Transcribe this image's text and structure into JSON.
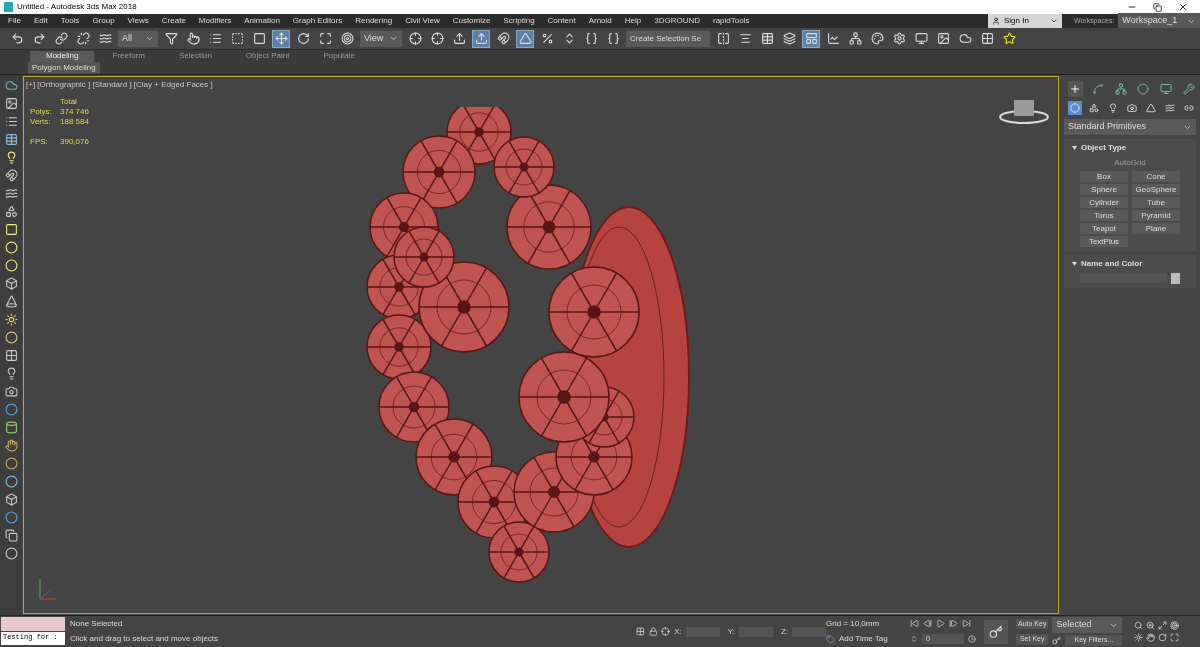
{
  "window": {
    "title": "Untitled - Autodesk 3ds Max 2018"
  },
  "menu": [
    "File",
    "Edit",
    "Tools",
    "Group",
    "Views",
    "Create",
    "Modifiers",
    "Animation",
    "Graph Editors",
    "Rendering",
    "Civil View",
    "Customize",
    "Scripting",
    "Content",
    "Arnold",
    "Help",
    "3DGROUND",
    "rapidTools"
  ],
  "account": {
    "sign_in": "Sign In",
    "workspaces_label": "Workspaces:",
    "workspace": "Workspace_1"
  },
  "toolbar": {
    "selection_filter": "All",
    "reference_coord": "View",
    "named_selection": "Create Selection Se",
    "buttons": [
      {
        "kind": "undo",
        "selected": false
      },
      {
        "kind": "redo",
        "selected": false
      },
      {
        "kind": "link",
        "selected": false
      },
      {
        "kind": "unlink",
        "selected": false
      },
      {
        "kind": "bind",
        "selected": false
      },
      {
        "kind": "filter",
        "selected": false
      },
      {
        "kind": "select",
        "selected": false
      },
      {
        "kind": "list",
        "selected": false
      },
      {
        "kind": "region",
        "selected": false
      },
      {
        "kind": "window",
        "selected": false
      },
      {
        "kind": "move",
        "selected": true
      },
      {
        "kind": "rotate",
        "selected": false
      },
      {
        "kind": "scale",
        "selected": false
      },
      {
        "kind": "place",
        "selected": false
      },
      {
        "kind": "coord",
        "selected": false
      },
      {
        "kind": "pivot",
        "selected": false
      },
      {
        "kind": "manip",
        "selected": false
      },
      {
        "kind": "keyboard",
        "selected": true
      },
      {
        "kind": "snap",
        "selected": false
      },
      {
        "kind": "angle",
        "selected": true
      },
      {
        "kind": "percent",
        "selected": false
      },
      {
        "kind": "spinner",
        "selected": false
      },
      {
        "kind": "edit-named",
        "selected": false
      },
      {
        "kind": "named",
        "selected": false
      },
      {
        "kind": "mirror",
        "selected": false
      },
      {
        "kind": "align",
        "selected": false
      },
      {
        "kind": "layers",
        "selected": false
      },
      {
        "kind": "layer-stack",
        "selected": false
      },
      {
        "kind": "ribbon",
        "selected": true
      },
      {
        "kind": "curve",
        "selected": false
      },
      {
        "kind": "schematic",
        "selected": false
      },
      {
        "kind": "material",
        "selected": false
      },
      {
        "kind": "render-setup",
        "selected": false
      },
      {
        "kind": "render-frame",
        "selected": false
      },
      {
        "kind": "render",
        "selected": false
      },
      {
        "kind": "cloud",
        "selected": false
      },
      {
        "kind": "grid",
        "selected": false
      },
      {
        "kind": "star",
        "selected": false
      }
    ]
  },
  "ribbon": {
    "tabs": [
      {
        "label": "Modeling",
        "selected": true
      },
      {
        "label": "Freeform",
        "selected": false
      },
      {
        "label": "Selection",
        "selected": false
      },
      {
        "label": "Object Paint",
        "selected": false
      },
      {
        "label": "Populate",
        "selected": false
      }
    ],
    "panel": "Polygon Modeling"
  },
  "viewport": {
    "label": "[+] [Orthographic ] [Standard ] [Clay + Edged Faces ]",
    "stats_header": "Total",
    "stats": [
      {
        "label": "Polys:",
        "value": "374 746"
      },
      {
        "label": "Verts:",
        "value": "188 584"
      }
    ],
    "fps_label": "FPS:",
    "fps": "390,076"
  },
  "command_panel": {
    "tabs": [
      {
        "kind": "create",
        "selected": true
      },
      {
        "kind": "modify",
        "selected": false
      },
      {
        "kind": "hierarchy",
        "selected": false
      },
      {
        "kind": "motion",
        "selected": false
      },
      {
        "kind": "display",
        "selected": false
      },
      {
        "kind": "utilities",
        "selected": false
      }
    ],
    "categories": [
      {
        "kind": "geometry",
        "selected": true
      },
      {
        "kind": "shapes",
        "selected": false
      },
      {
        "kind": "lights",
        "selected": false
      },
      {
        "kind": "cameras",
        "selected": false
      },
      {
        "kind": "helpers",
        "selected": false
      },
      {
        "kind": "spacewarps",
        "selected": false
      },
      {
        "kind": "systems",
        "selected": false
      }
    ],
    "dropdown": "Standard Primitives",
    "object_type": {
      "title": "Object Type",
      "autogrid": "AutoGrid",
      "autogrid_disabled": true,
      "buttons": [
        "Box",
        "Cone",
        "Sphere",
        "GeoSphere",
        "Cylinder",
        "Tube",
        "Torus",
        "Pyramid",
        "Teapot",
        "Plane",
        "TextPlus"
      ]
    },
    "name_and_color": {
      "title": "Name and Color"
    }
  },
  "status": {
    "maxscript": "Testing for :",
    "selection": "None Selected",
    "prompt": "Click and drag to select and move objects",
    "x_label": "X:",
    "y_label": "Y:",
    "z_label": "Z:",
    "grid": "Grid = 10,0mm",
    "add_time_tag": "Add Time Tag",
    "frame": "0",
    "auto_key": "Auto Key",
    "set_key": "Set Key",
    "key_mode": "Selected",
    "key_filters": "Key Filters..."
  }
}
